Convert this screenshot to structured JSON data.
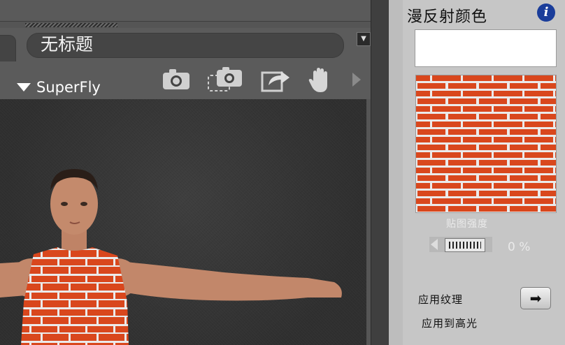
{
  "document_tab": {
    "title": "无标题"
  },
  "viewport": {
    "camera_label": "SuperFly"
  },
  "toolbar": {
    "icons": [
      "camera-icon",
      "camera-select-icon",
      "export-icon",
      "pan-hand-icon",
      "play-arrow-icon"
    ]
  },
  "panel": {
    "title": "漫反射颜色",
    "info_icon": "i",
    "color_swatch_hex": "#ffffff",
    "texture_label": "贴图强度",
    "strength_value": "0 %",
    "apply_texture_label": "应用纹理",
    "apply_highlight_label": "应用到高光",
    "apply_button_icon": "➡"
  },
  "colors": {
    "brick": "#d9471d",
    "mortar": "#ebeaea",
    "panel_bg": "#c6c6c6"
  }
}
